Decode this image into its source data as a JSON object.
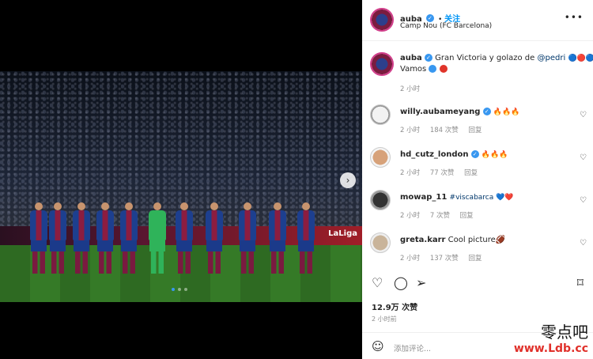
{
  "post": {
    "username": "auba",
    "follow_label": "关注",
    "location": "Camp Nou (FC Barcelona)",
    "caption": {
      "text": "Gran Victoria y golazo de ",
      "mention": "@pedri",
      "emoji_tail": "🔵🔴🔵🔴",
      "line2": "Vamos",
      "time": "2 小时"
    },
    "likes": "12.9万 次赞",
    "posted": "2 小时前",
    "comment_placeholder": "添加评论...",
    "carousel": {
      "count": 3,
      "active": 0
    }
  },
  "photo": {
    "ad_text": "LaLiga",
    "next_icon": "›"
  },
  "comments": [
    {
      "user": "willy.aubameyang",
      "verified": true,
      "text": "🔥🔥🔥",
      "time": "2 小时",
      "likes": "184 次赞",
      "reply": "回复"
    },
    {
      "user": "hd_cutz_london",
      "verified": true,
      "text": "🔥🔥🔥",
      "time": "2 小时",
      "likes": "77 次赞",
      "reply": "回复"
    },
    {
      "user": "mowap_11",
      "verified": false,
      "text": "#viscabarca 💙❤️",
      "time": "2 小时",
      "likes": "7 次赞",
      "reply": "回复"
    },
    {
      "user": "greta.karr",
      "verified": false,
      "text": "Cool picture🏈",
      "time": "2 小时",
      "likes": "137 次赞",
      "reply": "回复"
    }
  ],
  "icons": {
    "more": "more-horizontal-icon",
    "like": "heart-icon",
    "comment": "comment-icon",
    "share": "paper-plane-icon",
    "save": "bookmark-icon",
    "emoji": "smiley-icon"
  },
  "watermark": {
    "line1": "零点吧",
    "line2": "www.Ldb.cc"
  },
  "colors": {
    "accent": "#0095f6",
    "verified": "#3897f0",
    "fire": "#f0631e"
  }
}
